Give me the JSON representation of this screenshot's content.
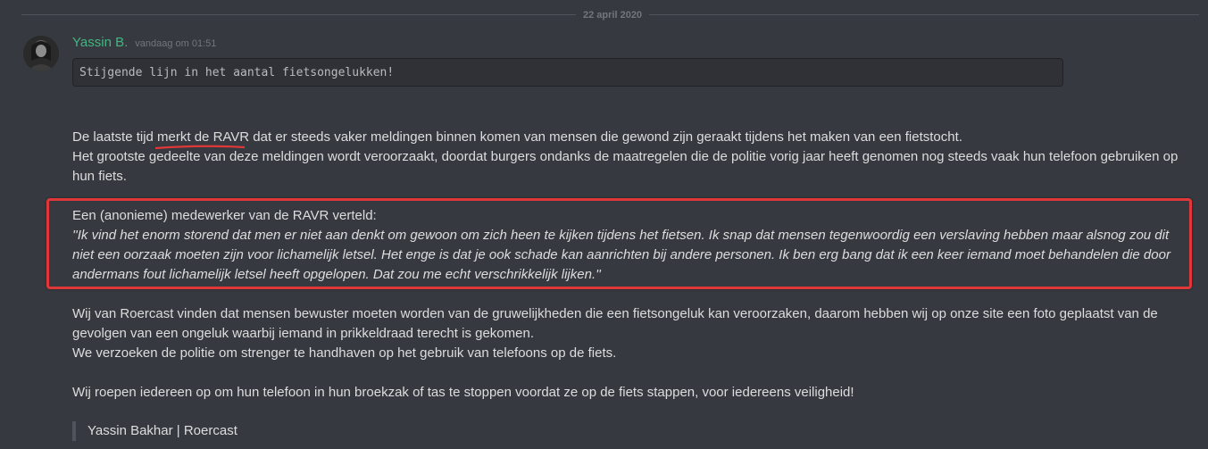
{
  "divider": {
    "date": "22 april 2020"
  },
  "message": {
    "author": "Yassin B.",
    "timestamp": "vandaag om 01:51",
    "code": "Stijgende lijn in het aantal fietsongelukken!",
    "p1": {
      "pre": "De laatste tijd ",
      "underlined": "merkt de RAVR",
      "post": " dat er steeds vaker meldingen binnen komen van mensen die gewond zijn geraakt tijdens het maken van een fietstocht.",
      "line2": "Het grootste gedeelte van deze meldingen wordt veroorzaakt, doordat burgers ondanks de maatregelen die de politie vorig jaar heeft genomen nog steeds vaak hun telefoon gebruiken op hun fiets."
    },
    "p2": {
      "intro": "Een (anonieme) medewerker van de RAVR verteld:",
      "quote": "''Ik vind het enorm storend dat men er niet aan denkt om gewoon om zich heen te kijken tijdens het fietsen. Ik snap dat mensen tegenwoordig een verslaving hebben maar alsnog zou dit niet een oorzaak moeten zijn voor lichamelijk letsel. Het enge is dat je ook schade kan aanrichten bij andere personen. Ik ben erg bang dat ik een keer iemand moet behandelen die door andermans fout lichamelijk letsel heeft opgelopen. Dat zou me echt verschrikkelijk lijken.''"
    },
    "p3": {
      "line1": "Wij van Roercast vinden dat mensen bewuster moeten worden van de gruwelijkheden die een fietsongeluk kan veroorzaken, daarom hebben wij op onze site een foto geplaatst van de gevolgen van een ongeluk waarbij iemand in prikkeldraad terecht is gekomen.",
      "line2": "We verzoeken de politie om strenger te handhaven op het gebruik van telefoons op de fiets."
    },
    "p4": "Wij roepen iedereen op om hun telefoon in hun broekzak of tas te stoppen voordat ze op de fiets stappen, voor iedereens veiligheid!",
    "signature": "Yassin Bakhar | Roercast"
  },
  "colors": {
    "background": "#36393f",
    "author": "#43b581",
    "annotation_red": "#e03838"
  }
}
